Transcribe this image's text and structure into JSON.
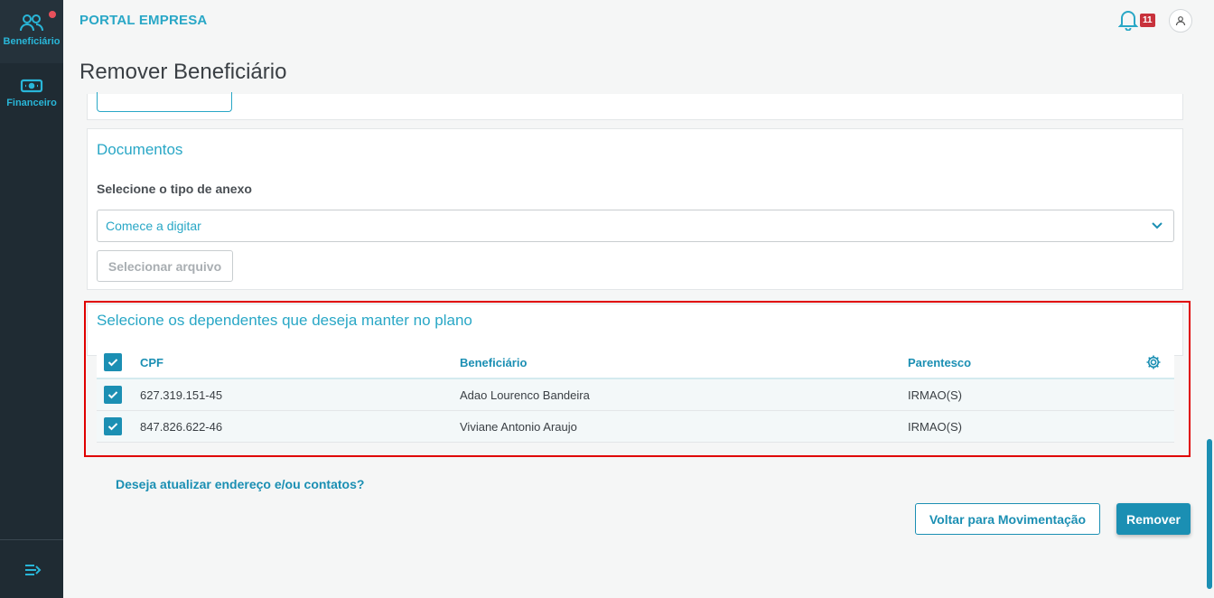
{
  "sidebar": {
    "items": [
      {
        "label": "Beneficiário",
        "icon": "users-icon"
      },
      {
        "label": "Financeiro",
        "icon": "money-icon"
      }
    ],
    "collapse_icon": "menu-collapse-icon"
  },
  "header": {
    "brand": "PORTAL EMPRESA",
    "notifications_count": "11",
    "bell_icon": "bell-icon",
    "user_icon": "user-icon"
  },
  "page": {
    "title": "Remover Beneficiário"
  },
  "documents": {
    "title": "Documentos",
    "attachment_label": "Selecione o tipo de anexo",
    "select_placeholder": "Comece a digitar",
    "file_button": "Selecionar arquivo"
  },
  "dependents": {
    "title": "Selecione os dependentes que deseja manter no plano",
    "columns": {
      "cpf": "CPF",
      "beneficiario": "Beneficiário",
      "parentesco": "Parentesco"
    },
    "rows": [
      {
        "cpf": "627.319.151-45",
        "beneficiario": "Adao Lourenco Bandeira",
        "parentesco": "IRMAO(S)",
        "checked": true
      },
      {
        "cpf": "847.826.622-46",
        "beneficiario": "Viviane Antonio Araujo",
        "parentesco": "IRMAO(S)",
        "checked": true
      }
    ],
    "all_checked": true
  },
  "actions": {
    "update_link": "Deseja atualizar endereço e/ou contatos?",
    "back_button": "Voltar para Movimentação",
    "remove_button": "Remover"
  },
  "colors": {
    "accent": "#29a7c6",
    "primary": "#1b8fb3",
    "sidebar": "#1f2b33",
    "highlight": "#e00000",
    "badge": "#c8323c"
  }
}
